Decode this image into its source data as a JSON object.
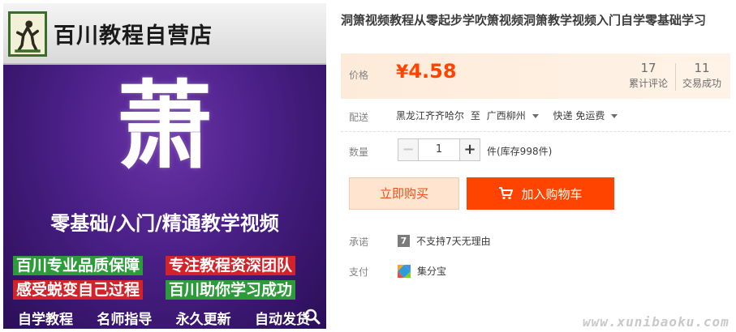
{
  "poster": {
    "store_name": "百川教程自营店",
    "logo_text": "百川教程自营店",
    "big_char": "萧",
    "subtitle": "零基础/入门/精通教学视频",
    "tags": [
      "百川专业品质保障",
      "专注教程资深团队",
      "感受蜕变自己过程",
      "百川助你学习成功"
    ],
    "features": [
      "自学教程",
      "名师指导",
      "永久更新",
      "自动发货"
    ]
  },
  "product": {
    "title": "洞箫视频教程从零起步学吹箫视频洞箫教学视频入门自学零基础学习"
  },
  "price": {
    "label": "价格",
    "currency": "¥",
    "value": "4.58",
    "reviews_count": "17",
    "reviews_label": "累计评论",
    "deals_count": "11",
    "deals_label": "交易成功"
  },
  "delivery": {
    "label": "配送",
    "from": "黑龙江齐齐哈尔",
    "to_word": "至",
    "to": "广西柳州",
    "shipping": "快递 免运费"
  },
  "quantity": {
    "label": "数量",
    "value": "1",
    "stock": "件(库存998件)"
  },
  "actions": {
    "buy_now": "立即购买",
    "add_to_cart": "加入购物车"
  },
  "promise": {
    "label": "承诺",
    "badge": "7",
    "text": "不支持7天无理由"
  },
  "payment": {
    "label": "支付",
    "method": "集分宝"
  },
  "watermark": "www.xunibaoku.com",
  "colors": {
    "accent": "#ff4400",
    "price_bg": "#fdebd9",
    "buy_now_bg": "#ffe4d0",
    "poster_purple": "#4a1f86"
  }
}
